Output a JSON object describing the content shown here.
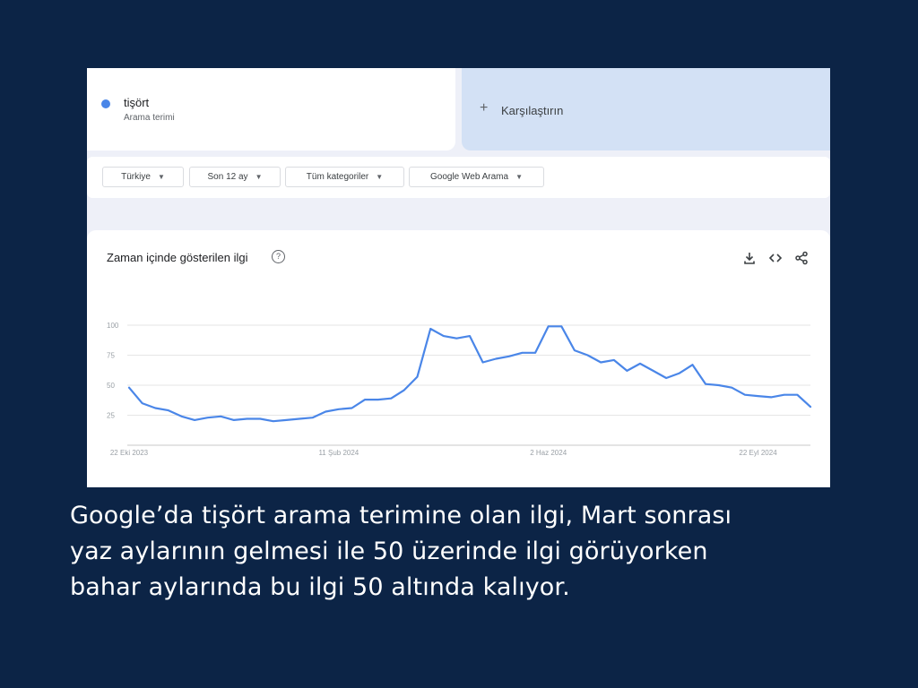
{
  "search_term": {
    "name": "tişört",
    "type": "Arama terimi",
    "color": "#4a86e8"
  },
  "compare": {
    "label": "Karşılaştırın",
    "icon": "plus-icon"
  },
  "filters": [
    {
      "label": "Türkiye"
    },
    {
      "label": "Son 12 ay"
    },
    {
      "label": "Tüm kategoriler"
    },
    {
      "label": "Google Web Arama"
    }
  ],
  "chart": {
    "title": "Zaman içinde gösterilen ilgi",
    "icons": [
      "help-icon",
      "download-icon",
      "embed-icon",
      "share-icon"
    ]
  },
  "chart_data": {
    "type": "line",
    "title": "Zaman içinde gösterilen ilgi",
    "xlabel": "",
    "ylabel": "",
    "ylim": [
      0,
      100
    ],
    "yticks": [
      25,
      50,
      75,
      100
    ],
    "x_tick_labels": [
      "22 Eki 2023",
      "11 Şub 2024",
      "2 Haz 2024",
      "22 Eyl 2024"
    ],
    "x_tick_indices": [
      0,
      16,
      32,
      48
    ],
    "grid": true,
    "series": [
      {
        "color": "#4a86e8",
        "values": [
          48,
          35,
          31,
          29,
          24,
          21,
          23,
          24,
          21,
          22,
          22,
          20,
          21,
          22,
          23,
          28,
          30,
          31,
          38,
          38,
          39,
          46,
          57,
          97,
          91,
          89,
          91,
          69,
          72,
          74,
          77,
          77,
          99,
          99,
          79,
          75,
          69,
          71,
          62,
          68,
          62,
          56,
          60,
          67,
          51,
          50,
          48,
          42,
          41,
          40,
          42,
          42,
          32
        ]
      }
    ]
  },
  "caption": [
    "Google’da tişört arama terimine olan ilgi, Mart sonrası",
    "yaz aylarının gelmesi ile 50 üzerinde ilgi görüyorken",
    "bahar aylarında bu ilgi 50 altında kalıyor."
  ]
}
